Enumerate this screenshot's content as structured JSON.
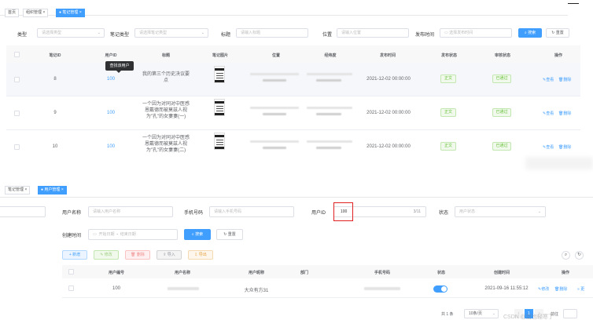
{
  "top": {
    "tabs": [
      "首页",
      "组织管理",
      "笔记管理"
    ],
    "filters": {
      "type_label": "类型",
      "type_placeholder": "请选择类型",
      "note_type_label": "笔记类型",
      "note_type_placeholder": "请选择笔记类型",
      "title_label": "标题",
      "title_placeholder": "请输入标题",
      "position_label": "位置",
      "position_placeholder": "请输入位置",
      "publish_label": "发布时间",
      "publish_placeholder": "选择发布时间",
      "search": "搜索",
      "reset": "重置"
    },
    "table": {
      "headers": [
        "笔记ID",
        "用户ID",
        "标题",
        "笔记图片",
        "位置",
        "经纬度",
        "发布时间",
        "发布状态",
        "审核状态",
        "操作"
      ],
      "tooltip": "查找该用户",
      "rows": [
        {
          "note_id": "8",
          "user_id": "100",
          "title": "我的第三个历史决议要点",
          "time": "2021-12-02 00:00:00",
          "publish": "正文",
          "audit": "已通过",
          "view": "查看",
          "delete": "删除"
        },
        {
          "note_id": "9",
          "user_id": "100",
          "title": "一个因为对同对中医感恩戴德而被莫兹人视为\"孔\"的女妻妻(一)",
          "time": "2021-12-02 00:00:00",
          "publish": "正文",
          "audit": "已通过",
          "view": "查看",
          "delete": "删除"
        },
        {
          "note_id": "10",
          "user_id": "100",
          "title": "一个因为对同对中医感恩戴德而被莫兹人视为\"孔\"的女妻妻(二)",
          "time": "2021-12-02 00:00:00",
          "publish": "正文",
          "audit": "已通过",
          "view": "查看",
          "delete": "删除"
        }
      ]
    }
  },
  "bottom": {
    "tabs": [
      "笔记管理",
      "用户管理"
    ],
    "filters": {
      "username_label": "用户名称",
      "username_placeholder": "请输入用户名称",
      "phone_label": "手机号码",
      "phone_placeholder": "请输入手机号码",
      "userid_label": "用户ID",
      "userid_value": "100",
      "userid_count": "3/11",
      "status_label": "状态",
      "status_placeholder": "用户状态",
      "created_label": "创建时间",
      "start_placeholder": "开始日期",
      "date_sep": "-",
      "end_placeholder": "结束日期",
      "search": "搜索",
      "reset": "重置"
    },
    "actions": {
      "add": "新增",
      "edit": "修改",
      "delete": "删除",
      "import": "导入",
      "export": "导出"
    },
    "table": {
      "headers": [
        "用户编号",
        "用户名称",
        "用户昵称",
        "部门",
        "手机号码",
        "状态",
        "创建时间",
        "操作"
      ],
      "row": {
        "id": "100",
        "nickname": "大众有方31",
        "created": "2021-09-16 11:55:12",
        "edit": "修改",
        "delete": "删除"
      }
    },
    "pagination": {
      "total": "共 1 条",
      "page_size": "10条/页",
      "page": "1",
      "goto": "前往"
    },
    "watermark": "CSDN @甜也轻寒了"
  },
  "colors": {
    "primary": "#409eff",
    "success": "#67c23a",
    "danger": "#f56c6c",
    "warning": "#e6a23c",
    "highlight_border": "#e02020"
  }
}
